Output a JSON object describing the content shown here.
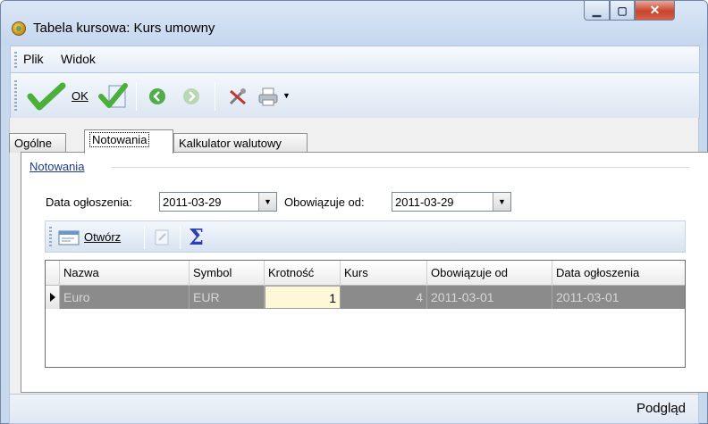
{
  "window": {
    "title": "Tabela kursowa: Kurs umowny",
    "app_icon": "app-coin-icon",
    "controls": [
      "minimize-icon",
      "maximize-icon",
      "close-icon"
    ]
  },
  "menu": {
    "plik": "Plik",
    "widok": "Widok"
  },
  "toolbar": {
    "ok_label": "OK",
    "icons": [
      "checkmark-icon",
      "checkmark-edit-icon",
      "back-arrow-icon",
      "forward-arrow-icon",
      "tools-icon",
      "printer-icon",
      "dropdown-arrow-icon"
    ],
    "accent_green": "#4caf3c"
  },
  "tabs": {
    "ogolne": "Ogólne",
    "notowania": "Notowania",
    "kalkulator": "Kalkulator walutowy",
    "active": "Notowania"
  },
  "group": {
    "title": "Notowania"
  },
  "filters": {
    "data_ogloszenia_label": "Data ogłoszenia:",
    "data_ogloszenia_value": "2011-03-29",
    "obowiazuje_od_label": "Obowiązuje od:",
    "obowiazuje_od_value": "2011-03-29"
  },
  "grid_toolbar": {
    "open_label": "Otwórz",
    "icons": [
      "open-icon",
      "edit-icon",
      "sigma-icon"
    ]
  },
  "grid": {
    "columns": [
      "Nazwa",
      "Symbol",
      "Krotność",
      "Kurs",
      "Obowiązuje od",
      "Data ogłoszenia"
    ],
    "rows": [
      [
        "Euro",
        "EUR",
        "1",
        "4",
        "2011-03-01",
        "2011-03-01"
      ]
    ],
    "selected_row_color": "#8b8b8b"
  },
  "status": {
    "text": "Podgląd"
  }
}
